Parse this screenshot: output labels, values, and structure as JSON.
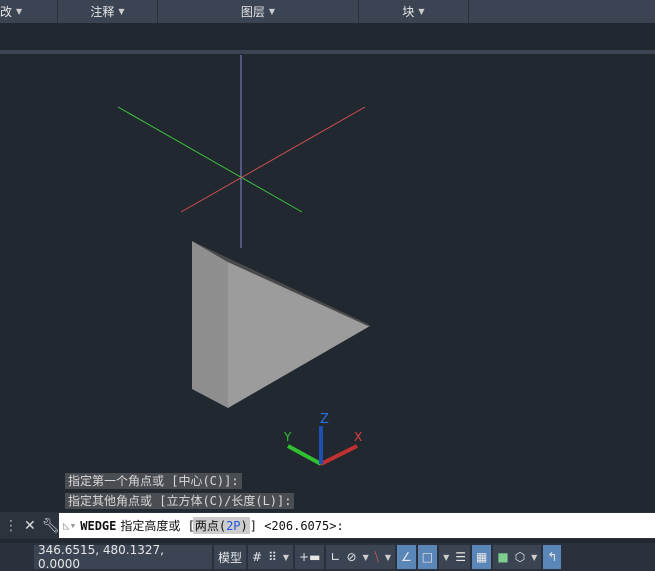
{
  "ribbon": {
    "panels": [
      {
        "label": "改"
      },
      {
        "label": "注释"
      },
      {
        "label": "图层"
      },
      {
        "label": "块"
      }
    ]
  },
  "history": [
    "指定第一个角点或 [中心(C)]:",
    "指定其他角点或 [立方体(C)/长度(L)]:"
  ],
  "command": {
    "name": "WEDGE",
    "prompt": "指定高度或 [",
    "option_pre": "两点(",
    "option_key": "2P",
    "option_post": ")",
    "suffix": "] <206.6075>:"
  },
  "ucs": {
    "x": "X",
    "y": "Y",
    "z": "Z"
  },
  "status": {
    "coordinates": "346.6515, 480.1327, 0.0000",
    "model": "模型"
  },
  "colors": {
    "x_axis": "#e04040",
    "y_axis": "#30c030",
    "z_axis": "#2a6fe0",
    "wedge": "#9a9a9a"
  }
}
